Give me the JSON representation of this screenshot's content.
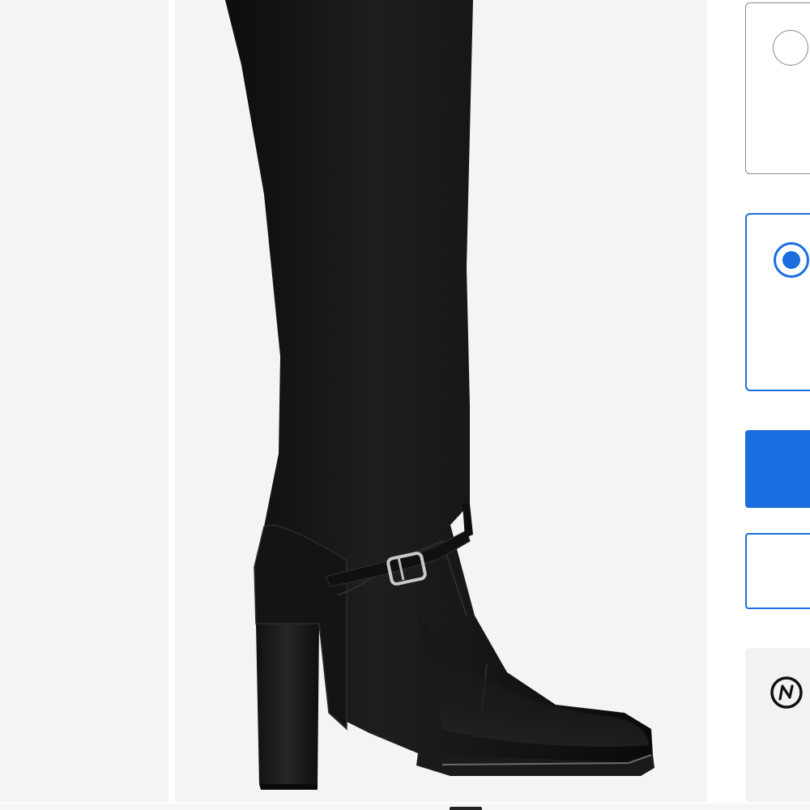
{
  "gallery": {
    "main_image_alt": "",
    "prev_thumbnail_alt": ""
  },
  "options": [
    {
      "label": "",
      "selected": false
    },
    {
      "label": "",
      "selected": true
    }
  ],
  "actions": {
    "primary_label": "",
    "secondary_label": ""
  },
  "info_panel": {
    "icon": "circled-n-icon",
    "text": ""
  },
  "colors": {
    "accent": "#1a6ee0",
    "image_background": "#f4f4f4",
    "border_neutral": "#8a8a8a",
    "panel_background": "#f2f2f2"
  }
}
